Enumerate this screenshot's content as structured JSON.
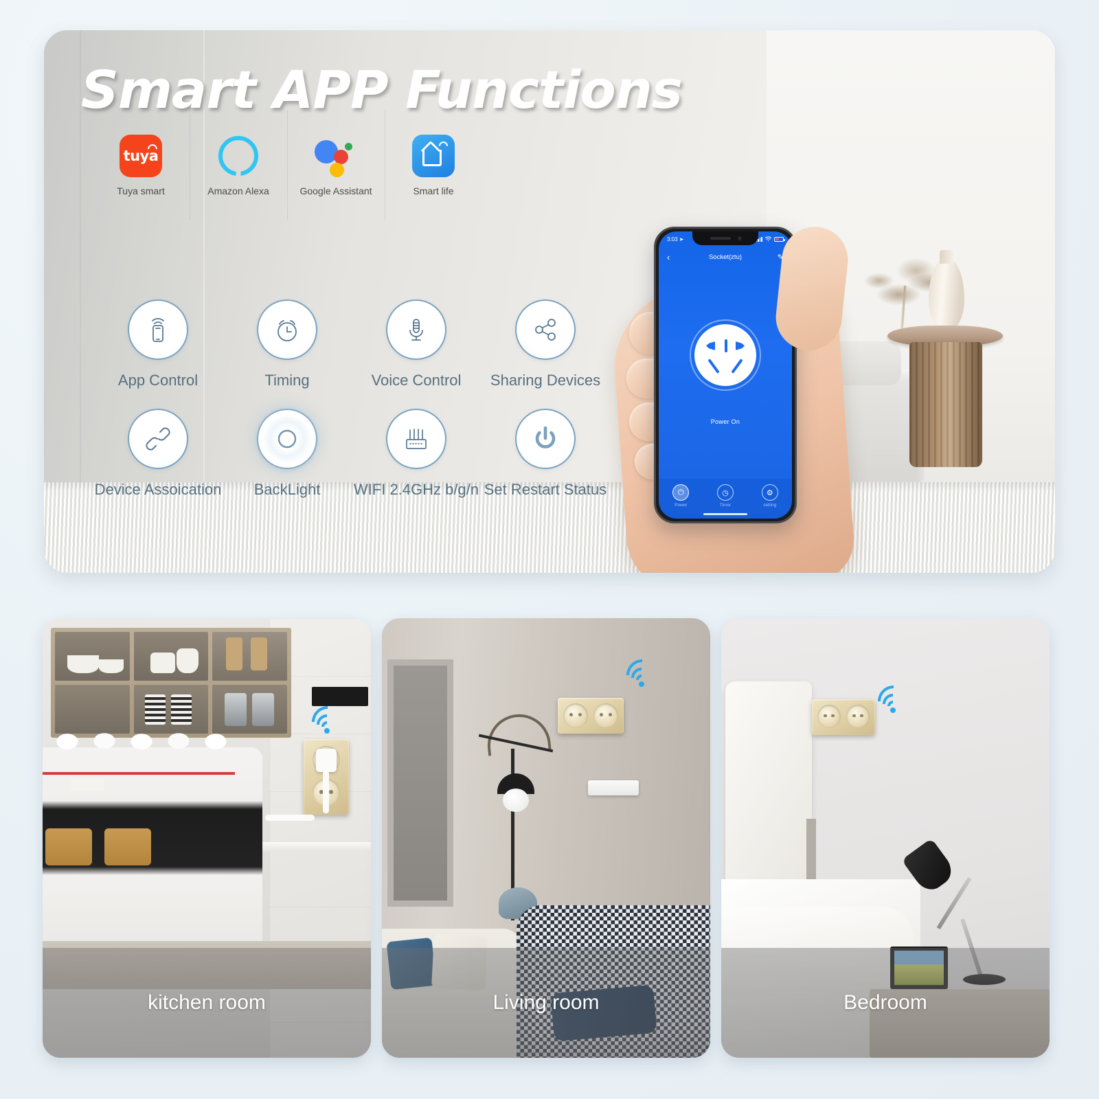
{
  "hero": {
    "title": "Smart APP Functions",
    "platforms": [
      {
        "icon": "tuya-icon",
        "label": "Tuya smart",
        "wordmark": "tuya",
        "color": "#f5441b"
      },
      {
        "icon": "amazon-alexa-icon",
        "label": "Amazon Alexa",
        "color": "#31c5f4"
      },
      {
        "icon": "google-assistant-icon",
        "label": "Google Assistant",
        "color": "#4285f4"
      },
      {
        "icon": "smart-life-icon",
        "label": "Smart life",
        "color": "#2a92e8"
      }
    ],
    "features": [
      {
        "icon": "phone-wifi-icon",
        "label": "App Control"
      },
      {
        "icon": "alarm-clock-icon",
        "label": "Timing"
      },
      {
        "icon": "microphone-icon",
        "label": "Voice Control"
      },
      {
        "icon": "share-nodes-icon",
        "label": "Sharing Devices"
      },
      {
        "icon": "chain-link-icon",
        "label": "Device Assoication"
      },
      {
        "icon": "backlight-ring-icon",
        "label": "BackLight"
      },
      {
        "icon": "router-icon",
        "label": "WIFI 2.4GHz b/g/n"
      },
      {
        "icon": "power-button-icon",
        "label": "Set Restart Status"
      }
    ]
  },
  "phone": {
    "status": {
      "time": "3:03",
      "location_icon": "location-arrow-icon",
      "signal_icon": "cellular-bars-icon",
      "wifi_icon": "wifi-icon",
      "battery_icon": "battery-icon"
    },
    "nav": {
      "back_icon": "chevron-left-icon",
      "title": "Socket(ztu)",
      "edit_icon": "pencil-icon"
    },
    "device": {
      "icon": "cn-socket-icon",
      "state_label": "Power On",
      "accent": "#1e6df0"
    },
    "tabs": [
      {
        "icon": "power-icon",
        "label": "Power",
        "active": true
      },
      {
        "icon": "timer-icon",
        "label": "Timer",
        "active": false
      },
      {
        "icon": "gear-icon",
        "label": "setting",
        "active": false
      }
    ]
  },
  "rooms": [
    {
      "label": "kitchen room",
      "wifi_icon": "wifi-signal-icon",
      "outlet_icon": "wall-outlet-icon"
    },
    {
      "label": "Living room",
      "wifi_icon": "wifi-signal-icon",
      "outlet_icon": "wall-outlet-icon"
    },
    {
      "label": "Bedroom",
      "wifi_icon": "wifi-signal-icon",
      "outlet_icon": "wall-outlet-icon"
    }
  ],
  "theme": {
    "page_bg": "#eef4f8",
    "ring_blue": "#7ba3c0",
    "label_blue": "#56707f",
    "wifi_blue": "#2aa9ef"
  }
}
